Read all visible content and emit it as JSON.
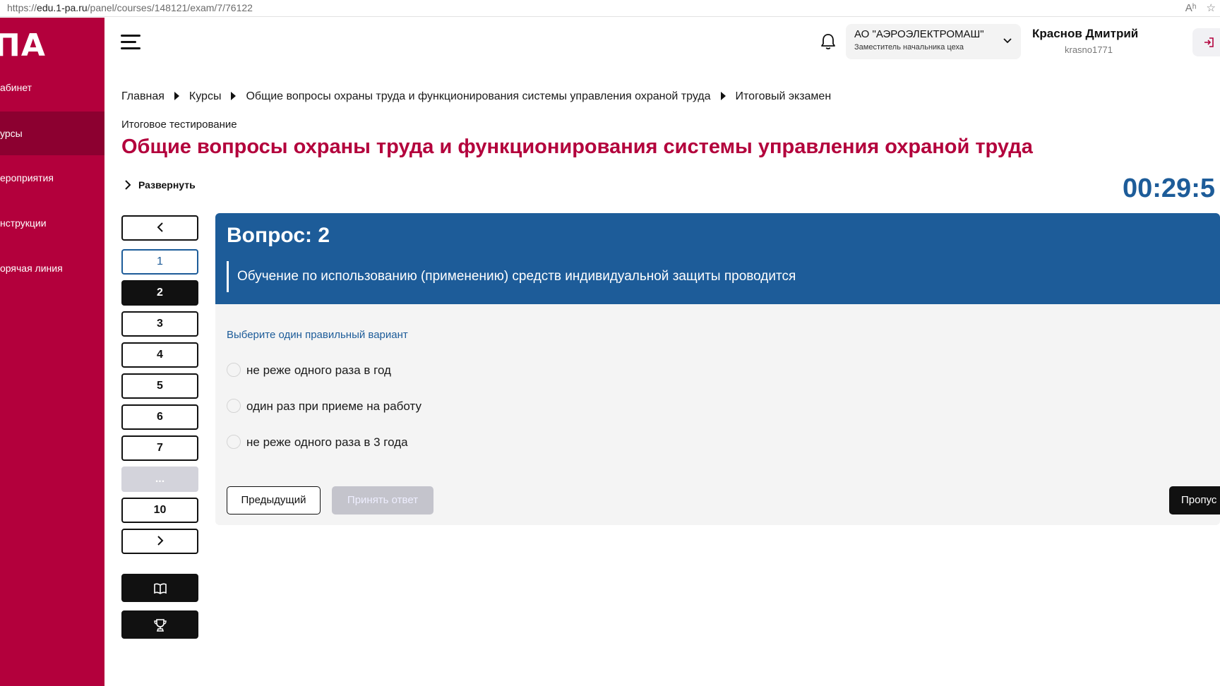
{
  "browser": {
    "url_prefix": "https://",
    "url_host": "edu.1-pa.ru",
    "url_path": "/panel/courses/148121/exam/7/76122"
  },
  "sidebar": {
    "logo": "ПА",
    "items": [
      {
        "label": "абинет",
        "active": false
      },
      {
        "label": "урсы",
        "active": true
      },
      {
        "label": "ероприятия",
        "active": false
      },
      {
        "label": "нструкции",
        "active": false
      },
      {
        "label": "орячая линия",
        "active": false
      }
    ]
  },
  "header": {
    "org_name": "АО \"АЭРОЭЛЕКТРОМАШ\"",
    "org_role": "Заместитель начальника цеха",
    "user_name": "Краснов Дмитрий",
    "user_login": "krasno1771"
  },
  "breadcrumb": [
    "Главная",
    "Курсы",
    "Общие вопросы охраны труда и функционирования системы управления охраной труда",
    "Итоговый экзамен"
  ],
  "page": {
    "subtitle": "Итоговое тестирование",
    "title": "Общие вопросы охраны труда и функционирования системы управления охраной труда",
    "expand_label": "Развернуть",
    "timer": "00:29:5"
  },
  "qnav": {
    "numbers": [
      "1",
      "2",
      "3",
      "4",
      "5",
      "6",
      "7",
      "...",
      "10"
    ],
    "current": "2",
    "answered": [
      "1"
    ]
  },
  "question": {
    "title": "Вопрос: 2",
    "text": "Обучение по использованию (применению) средств индивидуальной защиты проводится",
    "hint": "Выберите один правильный вариант",
    "options": [
      "не реже одного раза в год",
      "один раз при приеме на работу",
      "не реже одного раза в 3 года"
    ],
    "prev_label": "Предыдущий",
    "accept_label": "Принять ответ",
    "skip_label": "Пропус"
  },
  "colors": {
    "brand": "#b3003c",
    "sidebar_active": "#8c0030",
    "question_header": "#1d5c99",
    "timer": "#1d5c99"
  }
}
